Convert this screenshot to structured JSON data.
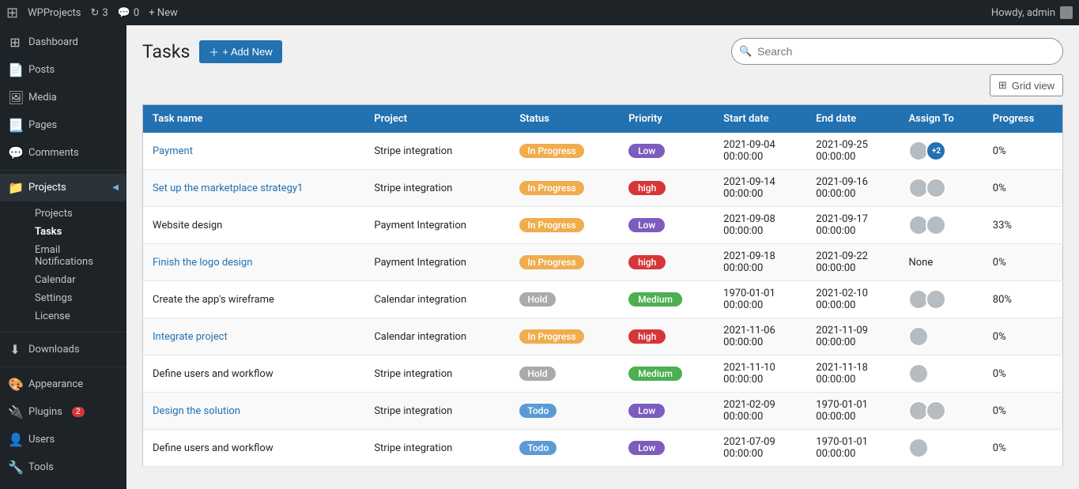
{
  "adminBar": {
    "wpLogo": "⊞",
    "siteName": "WPProjects",
    "updatesCount": "3",
    "commentsCount": "0",
    "newLabel": "+ New",
    "howdy": "Howdy, admin"
  },
  "sidebar": {
    "items": [
      {
        "id": "dashboard",
        "label": "Dashboard",
        "icon": "⊞"
      },
      {
        "id": "posts",
        "label": "Posts",
        "icon": "📄"
      },
      {
        "id": "media",
        "label": "Media",
        "icon": "🖼"
      },
      {
        "id": "pages",
        "label": "Pages",
        "icon": "📃"
      },
      {
        "id": "comments",
        "label": "Comments",
        "icon": "💬"
      },
      {
        "id": "projects",
        "label": "Projects",
        "icon": "📁"
      },
      {
        "id": "downloads",
        "label": "Downloads",
        "icon": "⬇"
      },
      {
        "id": "appearance",
        "label": "Appearance",
        "icon": "🎨"
      },
      {
        "id": "plugins",
        "label": "Plugins",
        "icon": "🔌",
        "badge": "2"
      },
      {
        "id": "users",
        "label": "Users",
        "icon": "👤"
      },
      {
        "id": "tools",
        "label": "Tools",
        "icon": "🔧"
      }
    ],
    "projectsSubItems": [
      {
        "id": "projects-list",
        "label": "Projects"
      },
      {
        "id": "tasks",
        "label": "Tasks",
        "active": true
      },
      {
        "id": "email-notifications",
        "label": "Email Notifications"
      },
      {
        "id": "calendar",
        "label": "Calendar"
      },
      {
        "id": "settings",
        "label": "Settings"
      },
      {
        "id": "license",
        "label": "License"
      }
    ]
  },
  "page": {
    "title": "Tasks",
    "addNewLabel": "+ Add New",
    "searchPlaceholder": "Search",
    "gridViewLabel": "Grid view"
  },
  "table": {
    "columns": [
      "Task name",
      "Project",
      "Status",
      "Priority",
      "Start date",
      "End date",
      "Assign To",
      "Progress"
    ],
    "rows": [
      {
        "taskName": "Payment",
        "taskLink": true,
        "project": "Stripe integration",
        "status": "In Progress",
        "statusClass": "status-inprogress",
        "priority": "Low",
        "priorityClass": "priority-low",
        "startDate": "2021-09-04\n00:00:00",
        "endDate": "2021-09-25\n00:00:00",
        "assignCount": 3,
        "assignExtra": "+2",
        "progress": "0%"
      },
      {
        "taskName": "Set up the marketplace strategy1",
        "taskLink": true,
        "project": "Stripe integration",
        "status": "In Progress",
        "statusClass": "status-inprogress",
        "priority": "high",
        "priorityClass": "priority-high",
        "startDate": "2021-09-14\n00:00:00",
        "endDate": "2021-09-16\n00:00:00",
        "assignCount": 2,
        "assignExtra": null,
        "progress": "0%"
      },
      {
        "taskName": "Website design",
        "taskLink": false,
        "project": "Payment Integration",
        "status": "In Progress",
        "statusClass": "status-inprogress",
        "priority": "Low",
        "priorityClass": "priority-low",
        "startDate": "2021-09-08\n00:00:00",
        "endDate": "2021-09-17\n00:00:00",
        "assignCount": 2,
        "assignExtra": null,
        "progress": "33%"
      },
      {
        "taskName": "Finish the logo design",
        "taskLink": true,
        "project": "Payment Integration",
        "status": "In Progress",
        "statusClass": "status-inprogress",
        "priority": "high",
        "priorityClass": "priority-high",
        "startDate": "2021-09-18\n00:00:00",
        "endDate": "2021-09-22\n00:00:00",
        "assignCount": 0,
        "assignExtra": null,
        "assignNone": true,
        "progress": "0%"
      },
      {
        "taskName": "Create the app's wireframe",
        "taskLink": false,
        "project": "Calendar integration",
        "status": "Hold",
        "statusClass": "status-hold",
        "priority": "Medium",
        "priorityClass": "priority-medium",
        "startDate": "1970-01-01\n00:00:00",
        "endDate": "2021-02-10\n00:00:00",
        "assignCount": 2,
        "assignExtra": null,
        "progress": "80%"
      },
      {
        "taskName": "Integrate project",
        "taskLink": true,
        "project": "Calendar integration",
        "status": "In Progress",
        "statusClass": "status-inprogress",
        "priority": "high",
        "priorityClass": "priority-high",
        "startDate": "2021-11-06\n00:00:00",
        "endDate": "2021-11-09\n00:00:00",
        "assignCount": 1,
        "assignExtra": null,
        "progress": "0%"
      },
      {
        "taskName": "Define users and workflow",
        "taskLink": false,
        "project": "Stripe integration",
        "status": "Hold",
        "statusClass": "status-hold",
        "priority": "Medium",
        "priorityClass": "priority-medium",
        "startDate": "2021-11-10\n00:00:00",
        "endDate": "2021-11-18\n00:00:00",
        "assignCount": 1,
        "assignExtra": null,
        "progress": "0%"
      },
      {
        "taskName": "Design the solution",
        "taskLink": true,
        "project": "Stripe integration",
        "status": "Todo",
        "statusClass": "status-todo",
        "priority": "Low",
        "priorityClass": "priority-low",
        "startDate": "2021-02-09\n00:00:00",
        "endDate": "1970-01-01\n00:00:00",
        "assignCount": 2,
        "assignExtra": null,
        "progress": "0%"
      },
      {
        "taskName": "Define users and workflow",
        "taskLink": false,
        "project": "Stripe integration",
        "status": "Todo",
        "statusClass": "status-todo",
        "priority": "Low",
        "priorityClass": "priority-low",
        "startDate": "2021-07-09\n00:00:00",
        "endDate": "1970-01-01\n00:00:00",
        "assignCount": 1,
        "assignExtra": null,
        "progress": "0%"
      }
    ]
  }
}
